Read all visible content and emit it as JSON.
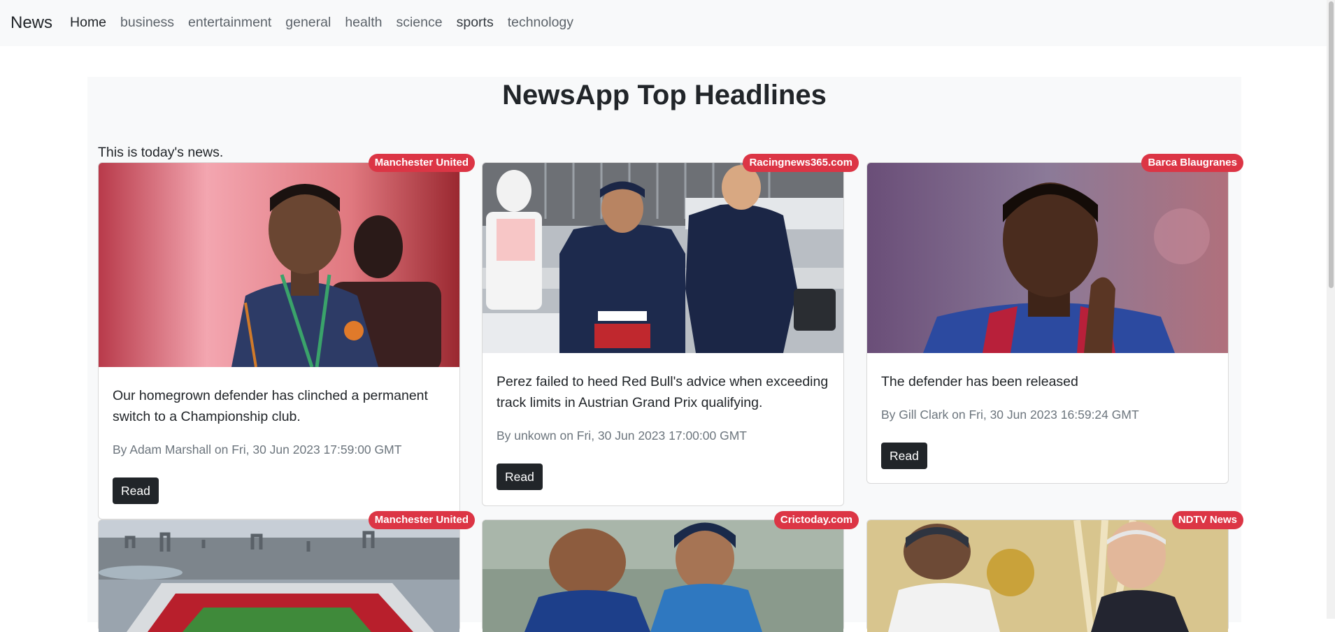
{
  "navbar": {
    "brand": "News",
    "links": [
      "Home",
      "business",
      "entertainment",
      "general",
      "health",
      "science",
      "sports",
      "technology"
    ]
  },
  "page": {
    "title": "NewsApp Top Headlines",
    "subtitle": "This is today's news."
  },
  "articles": [
    {
      "source": "Manchester United",
      "description": "Our homegrown defender has clinched a permanent switch to a Championship club.",
      "meta": "By Adam Marshall on Fri, 30 Jun 2023 17:59:00 GMT",
      "button": "Read"
    },
    {
      "source": "Racingnews365.com",
      "description": "Perez failed to heed Red Bull's advice when exceeding track limits in Austrian Grand Prix qualifying.",
      "meta": "By unkown on Fri, 30 Jun 2023 17:00:00 GMT",
      "button": "Read"
    },
    {
      "source": "Barca Blaugranes",
      "description": "The defender has been released",
      "meta": "By Gill Clark on Fri, 30 Jun 2023 16:59:24 GMT",
      "button": "Read"
    },
    {
      "source": "Manchester United"
    },
    {
      "source": "Crictoday.com"
    },
    {
      "source": "NDTV News"
    }
  ],
  "colors": {
    "navbar_bg": "#f8f9fa",
    "badge": "#dc3545",
    "button": "#212529",
    "muted_text": "#6c757d"
  }
}
